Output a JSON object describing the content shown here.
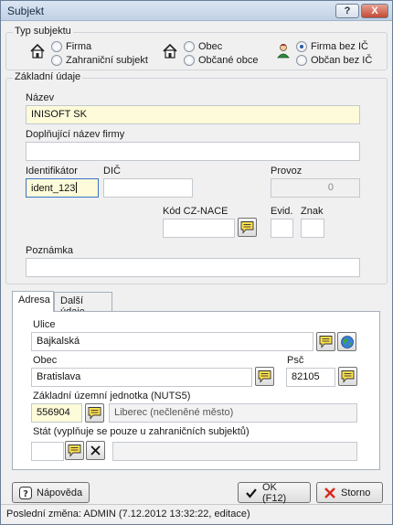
{
  "window": {
    "title": "Subjekt",
    "help_label": "?",
    "close_label": "X"
  },
  "typ_subjektu": {
    "label": "Typ subjektu",
    "options": {
      "firma": "Firma",
      "zahranicni": "Zahraniční subjekt",
      "obec": "Obec",
      "obcane_obce": "Občané obce",
      "firma_bez_ic": "Firma bez IČ",
      "obcan_bez_ic": "Občan bez IČ"
    },
    "selected": "Firma bez IČ"
  },
  "zakladni": {
    "label": "Základní údaje",
    "nazev_label": "Název",
    "nazev_value": "INISOFT SK",
    "doplnujici_label": "Doplňující název firmy",
    "doplnujici_value": "",
    "identifikator_label": "Identifikátor",
    "identifikator_value": "ident_123",
    "dic_label": "DIČ",
    "dic_value": "",
    "provoz_label": "Provoz",
    "provoz_value": "0",
    "kod_label": "Kód CZ-NACE",
    "kod_value": "",
    "evid_label": "Evid.",
    "evid_value": "",
    "znak_label": "Znak",
    "znak_value": "",
    "poznamka_label": "Poznámka",
    "poznamka_value": ""
  },
  "tabs": {
    "adresa": "Adresa",
    "dalsi": "Další údaje"
  },
  "adresa": {
    "ulice_label": "Ulice",
    "ulice_value": "Bajkalská",
    "obec_label": "Obec",
    "obec_value": "Bratislava",
    "psc_label": "Psč",
    "psc_value": "82105",
    "nuts_label": "Základní územní jednotka (NUTS5)",
    "nuts_code": "556904",
    "nuts_name": "Liberec (nečleněné město)",
    "stat_label": "Stát (vyplňuje se pouze u zahraničních subjektů)",
    "stat_code": "",
    "stat_name": ""
  },
  "buttons": {
    "help": "Nápověda",
    "ok": "OK (F12)",
    "cancel": "Storno"
  },
  "status": "Poslední změna: ADMIN (7.12.2012 13:32:22, editace)",
  "colors": {
    "field_highlight": "#fdfbd9",
    "focus_border": "#3b73c7",
    "title_gradient": "#c0d1e6"
  }
}
